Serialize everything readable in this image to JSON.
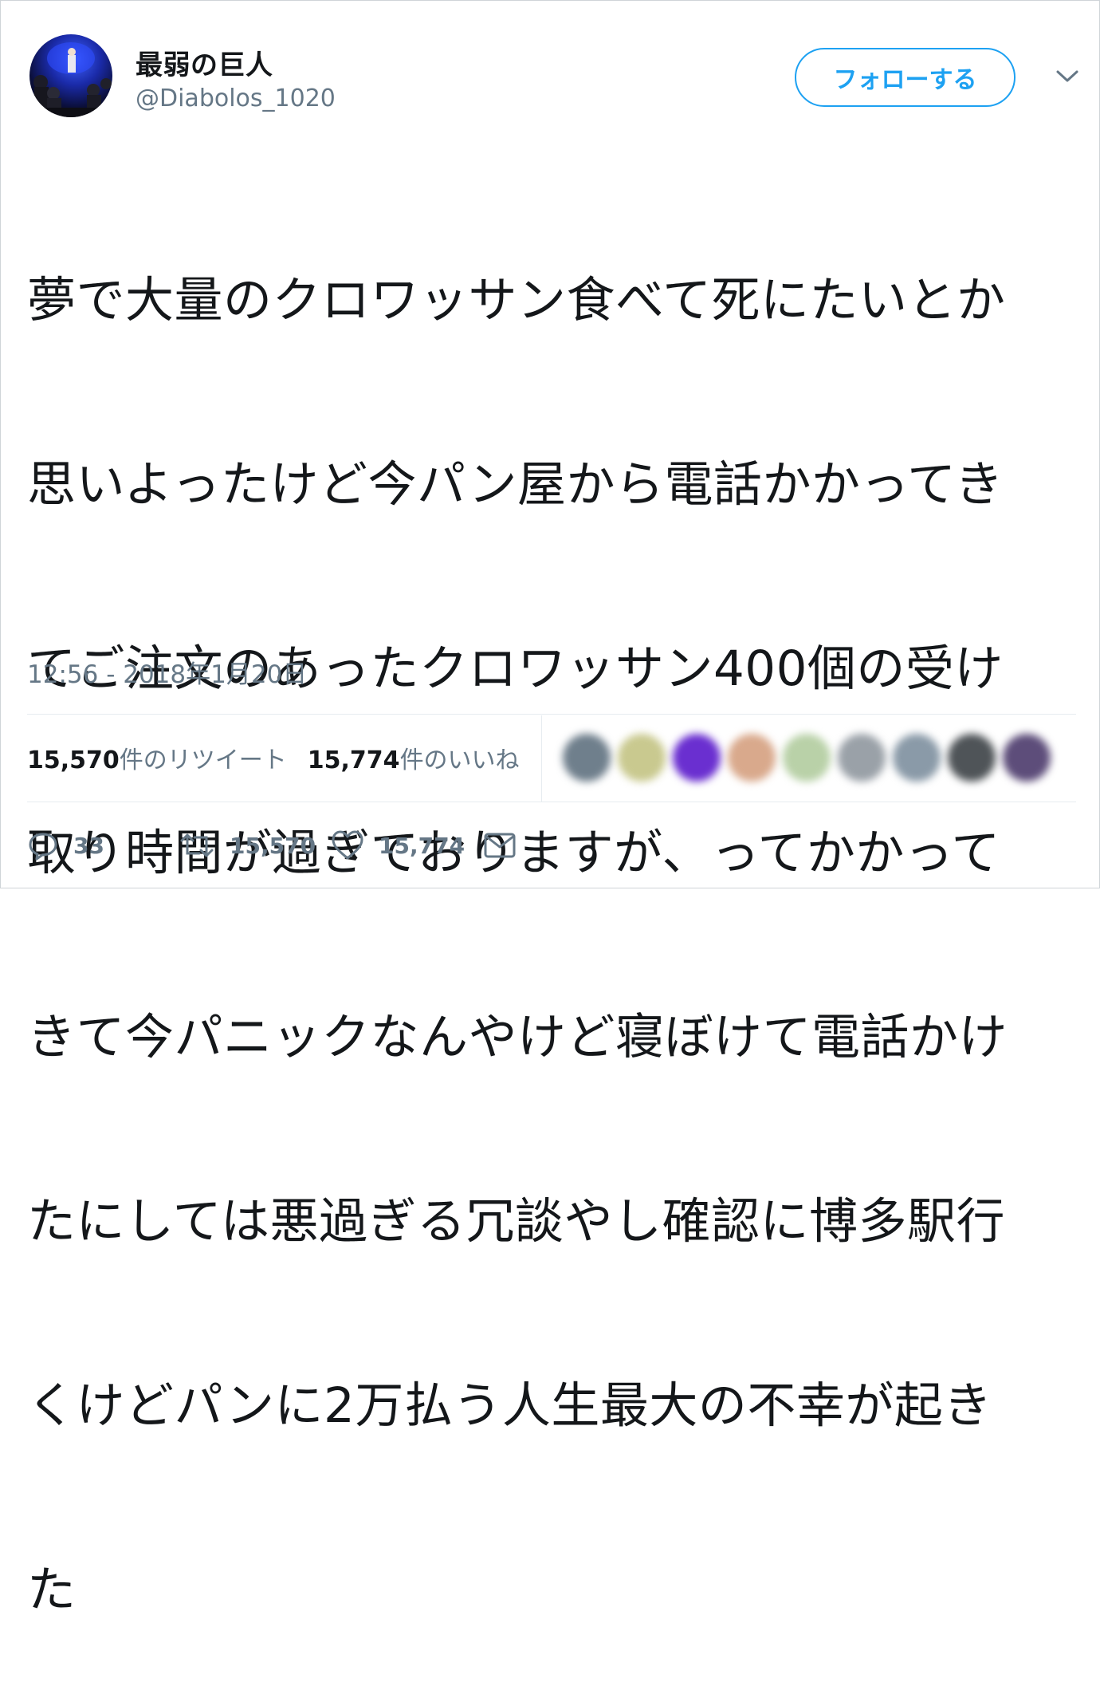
{
  "user": {
    "display_name": "最弱の巨人",
    "handle": "@Diabolos_1020"
  },
  "follow_button": {
    "label": "フォローする"
  },
  "tweet": {
    "lines": [
      "夢で大量のクロワッサン食べて死にたいとか",
      "思いよったけど今パン屋から電話かかってき",
      "てご注文のあったクロワッサン400個の受け",
      "取り時間が過ぎておりますが、ってかかって",
      "きて今パニックなんやけど寝ぼけて電話かけ",
      "たにしては悪過ぎる冗談やし確認に博多駅行",
      "くけどパンに2万払う人生最大の不幸が起き",
      "た"
    ],
    "timestamp": "12:56 - 2018年1月20日"
  },
  "stats": {
    "retweet_count": "15,570",
    "retweet_label": "件のリツイート",
    "like_count": "15,774",
    "like_label": "件のいいね"
  },
  "liker_avatars": [
    "#6f7f8c",
    "#c9c98f",
    "#6a2fd0",
    "#d9a98c",
    "#b9d1a8",
    "#9aa1a8",
    "#8a9aa8",
    "#4f5458",
    "#5d4d7a"
  ],
  "actions": {
    "reply_icon": "reply-icon",
    "reply_count": "33",
    "retweet_icon": "retweet-icon",
    "retweet_count": "15,570",
    "like_icon": "heart-icon",
    "like_count": "15,774",
    "dm_icon": "envelope-icon"
  },
  "colors": {
    "accent": "#1da1f2",
    "text": "#14171a",
    "muted": "#657786"
  }
}
